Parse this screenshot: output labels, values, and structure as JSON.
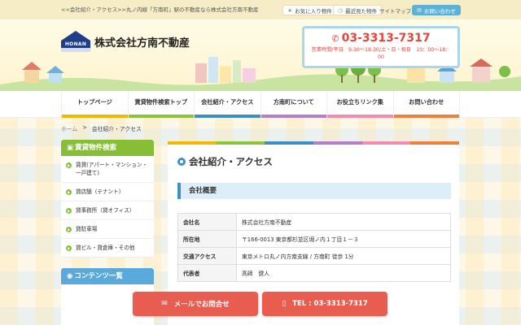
{
  "topbar": {
    "tagline": "<<会社紹介・アクセス>>丸ノ内線「方南町」駅の不動産なら株式会社方南不動産",
    "favorites_label": "お気に入り物件",
    "recent_label": "最近見た物件",
    "sitemap_label": "サイトマップ",
    "contact_label": "お問い合わせ"
  },
  "header": {
    "logo_text": "HONAN",
    "company_name": "株式会社方南不動産",
    "phone": "03-3313-7317",
    "hours": "営業時間/平日　9:30～18:30/土・日・祝日　10：00～18：00"
  },
  "nav": {
    "items": [
      {
        "label": "トップページ",
        "color": "#f0b800"
      },
      {
        "label": "賃貸物件検索トップ",
        "color": "#8cc43a"
      },
      {
        "label": "会社紹介・アクセス",
        "color": "#3d8fc6"
      },
      {
        "label": "方南町について",
        "color": "#b47fc5"
      },
      {
        "label": "お役立ちリンク集",
        "color": "#f08cb0"
      },
      {
        "label": "お問い合わせ",
        "color": "#ef7f3a"
      }
    ]
  },
  "breadcrumb": {
    "home": "ホーム",
    "separator": ">",
    "current": "会社紹介・アクセス"
  },
  "sidebar": {
    "search": {
      "title": "賃貸物件検索",
      "color": "#88be35",
      "items": [
        "賃貸(アパート・マンション・一戸建て)",
        "貸店舗（テナント）",
        "貸事務所（貸オフィス）",
        "貸駐車場",
        "貸ビル・貸倉庫・その他"
      ]
    },
    "contents": {
      "title": "コンテンツ一覧",
      "color": "#5aa9dc"
    }
  },
  "main": {
    "page_title": "会社紹介・アクセス",
    "section_title": "会社概要",
    "rainbow": [
      "#f0b800",
      "#8cc43a",
      "#3d8fc6",
      "#b47fc5",
      "#f08cb0",
      "#ef7f3a"
    ],
    "overview": [
      {
        "key": "会社名",
        "value": "株式会社方南不動産"
      },
      {
        "key": "所在地",
        "value": "〒166-0013 東京都杉並区堀ノ内１丁目１－３"
      },
      {
        "key": "交通アクセス",
        "value": "東京メトロ丸ノ内方南支線 / 方南町 徒歩 1分"
      },
      {
        "key": "代表者",
        "value": "髙師　健人"
      }
    ]
  },
  "actions": {
    "mail_label": "メールでお問合せ",
    "tel_label": "TEL : 03-3313-7317"
  }
}
